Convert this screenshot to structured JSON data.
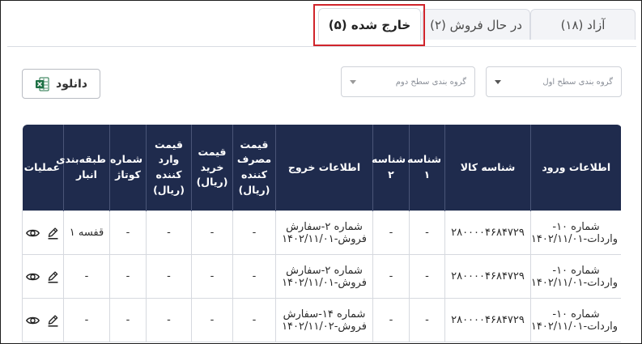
{
  "tabs": [
    {
      "label": "آزاد (۱۸)"
    },
    {
      "label": "در حال فروش (۲)"
    },
    {
      "label": "خارج شده (۵)"
    }
  ],
  "toolbar": {
    "download_label": "دانلود",
    "group_level1_placeholder": "گروه بندی سطح اول",
    "group_level2_placeholder": "گروه بندی سطح دوم"
  },
  "table": {
    "headers": [
      "اطلاعات ورود",
      "شناسه کالا",
      "شناسه ۱",
      "شناسه ۲",
      "اطلاعات خروج",
      "قیمت مصرف کننده (ریال)",
      "قیمت خرید (ریال)",
      "قیمت وارد کننده (ریال)",
      "شماره کوتاژ",
      "طبقه‌بندی انبار",
      "عملیات"
    ],
    "rows": [
      {
        "entry": "شماره ۱۰-واردات-۱۴۰۲/۱۱/۰۱",
        "sku": "۲۸۰۰۰۰۴۶۸۴۷۲۹",
        "id1": "-",
        "id2": "-",
        "exit": "شماره ۲-سفارش فروش-۱۴۰۲/۱۱/۰۱",
        "consumer_price": "-",
        "purchase_price": "-",
        "importer_price": "-",
        "cotage": "-",
        "storage": "قفسه ۱"
      },
      {
        "entry": "شماره ۱۰-واردات-۱۴۰۲/۱۱/۰۱",
        "sku": "۲۸۰۰۰۰۴۶۸۴۷۲۹",
        "id1": "-",
        "id2": "-",
        "exit": "شماره ۲-سفارش فروش-۱۴۰۲/۱۱/۰۱",
        "consumer_price": "-",
        "purchase_price": "-",
        "importer_price": "-",
        "cotage": "-",
        "storage": "-"
      },
      {
        "entry": "شماره ۱۰-واردات-۱۴۰۲/۱۱/۰۱",
        "sku": "۲۸۰۰۰۰۴۶۸۴۷۲۹",
        "id1": "-",
        "id2": "-",
        "exit": "شماره ۱۴-سفارش فروش-۱۴۰۲/۱۱/۰۲",
        "consumer_price": "-",
        "purchase_price": "-",
        "importer_price": "-",
        "cotage": "-",
        "storage": "-"
      }
    ]
  },
  "colors": {
    "header_bg": "#1f2b4d",
    "highlight": "#d0242b",
    "excel_green": "#1d7044"
  },
  "icons": [
    "excel-icon",
    "caret-down-icon",
    "view-eye-icon",
    "edit-pencil-icon"
  ]
}
